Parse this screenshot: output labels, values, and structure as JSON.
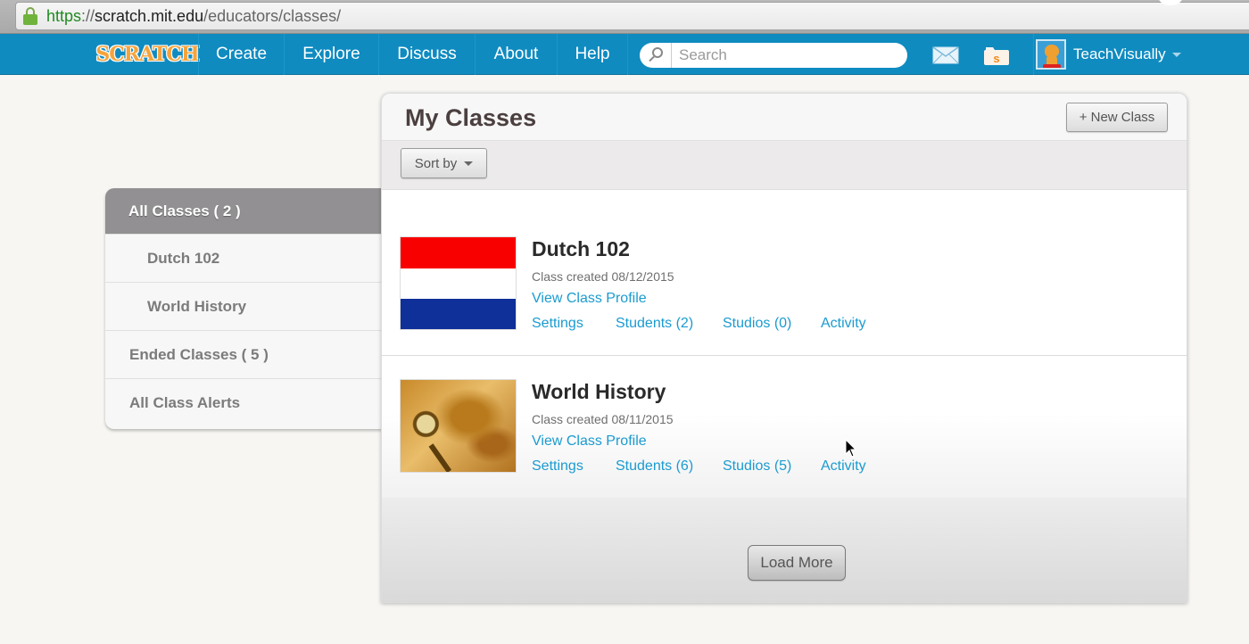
{
  "browser": {
    "url_scheme": "https",
    "url_separator": "://",
    "url_host": "scratch.mit.edu",
    "url_path": "/educators/classes/"
  },
  "nav": {
    "logo": "SCRATCH",
    "items": [
      {
        "label": "Create"
      },
      {
        "label": "Explore"
      },
      {
        "label": "Discuss"
      },
      {
        "label": "About"
      },
      {
        "label": "Help"
      }
    ],
    "search_placeholder": "Search",
    "messages_icon": "envelope-icon",
    "mystuff_icon": "folder-icon",
    "username": "TeachVisually"
  },
  "sidebar": {
    "items": [
      {
        "label": "All Classes ( 2 )",
        "active": true
      },
      {
        "label": "Dutch 102"
      },
      {
        "label": "World History"
      },
      {
        "label": "Ended Classes ( 5 )"
      },
      {
        "label": "All Class Alerts"
      }
    ]
  },
  "main": {
    "title": "My Classes",
    "new_class_label": "+ New Class",
    "sort_label": "Sort by",
    "classes": [
      {
        "name": "Dutch 102",
        "created": "Class created 08/12/2015",
        "profile_link": "View Class Profile",
        "settings": "Settings",
        "students": "Students (2)",
        "studios": "Studios (0)",
        "activity": "Activity",
        "flag_colors": [
          "#f80000",
          "#ffffff",
          "#0f2f99"
        ]
      },
      {
        "name": "World History",
        "created": "Class created 08/11/2015",
        "profile_link": "View Class Profile",
        "settings": "Settings",
        "students": "Students (6)",
        "studios": "Studios (5)",
        "activity": "Activity"
      }
    ],
    "load_more_label": "Load More"
  },
  "colors": {
    "nav_blue": "#0f8bc0",
    "link_blue": "#1a9bd0",
    "sidebar_active": "#929092"
  }
}
